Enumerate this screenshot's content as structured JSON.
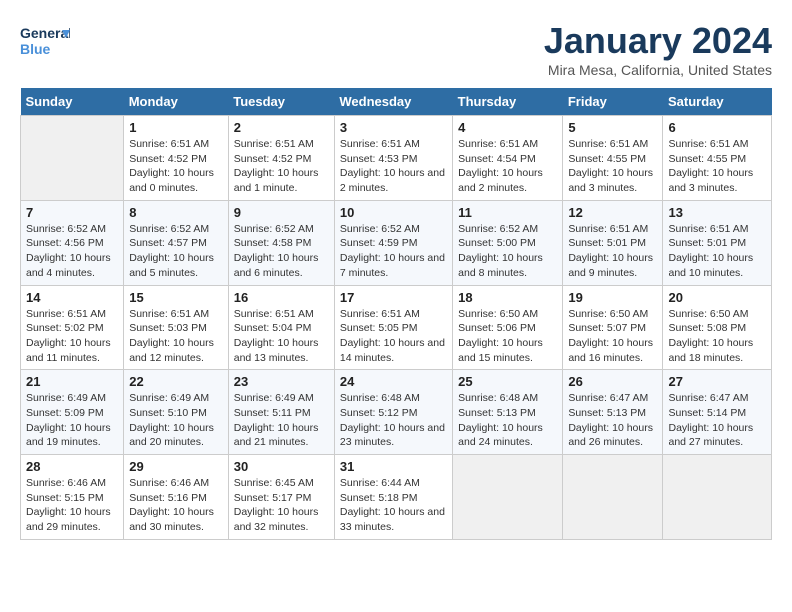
{
  "header": {
    "logo_general": "General",
    "logo_blue": "Blue",
    "title": "January 2024",
    "subtitle": "Mira Mesa, California, United States"
  },
  "days_of_week": [
    "Sunday",
    "Monday",
    "Tuesday",
    "Wednesday",
    "Thursday",
    "Friday",
    "Saturday"
  ],
  "weeks": [
    [
      {
        "day": "",
        "sunrise": "",
        "sunset": "",
        "daylight": ""
      },
      {
        "day": "1",
        "sunrise": "Sunrise: 6:51 AM",
        "sunset": "Sunset: 4:52 PM",
        "daylight": "Daylight: 10 hours and 0 minutes."
      },
      {
        "day": "2",
        "sunrise": "Sunrise: 6:51 AM",
        "sunset": "Sunset: 4:52 PM",
        "daylight": "Daylight: 10 hours and 1 minute."
      },
      {
        "day": "3",
        "sunrise": "Sunrise: 6:51 AM",
        "sunset": "Sunset: 4:53 PM",
        "daylight": "Daylight: 10 hours and 2 minutes."
      },
      {
        "day": "4",
        "sunrise": "Sunrise: 6:51 AM",
        "sunset": "Sunset: 4:54 PM",
        "daylight": "Daylight: 10 hours and 2 minutes."
      },
      {
        "day": "5",
        "sunrise": "Sunrise: 6:51 AM",
        "sunset": "Sunset: 4:55 PM",
        "daylight": "Daylight: 10 hours and 3 minutes."
      },
      {
        "day": "6",
        "sunrise": "Sunrise: 6:51 AM",
        "sunset": "Sunset: 4:55 PM",
        "daylight": "Daylight: 10 hours and 3 minutes."
      }
    ],
    [
      {
        "day": "7",
        "sunrise": "Sunrise: 6:52 AM",
        "sunset": "Sunset: 4:56 PM",
        "daylight": "Daylight: 10 hours and 4 minutes."
      },
      {
        "day": "8",
        "sunrise": "Sunrise: 6:52 AM",
        "sunset": "Sunset: 4:57 PM",
        "daylight": "Daylight: 10 hours and 5 minutes."
      },
      {
        "day": "9",
        "sunrise": "Sunrise: 6:52 AM",
        "sunset": "Sunset: 4:58 PM",
        "daylight": "Daylight: 10 hours and 6 minutes."
      },
      {
        "day": "10",
        "sunrise": "Sunrise: 6:52 AM",
        "sunset": "Sunset: 4:59 PM",
        "daylight": "Daylight: 10 hours and 7 minutes."
      },
      {
        "day": "11",
        "sunrise": "Sunrise: 6:52 AM",
        "sunset": "Sunset: 5:00 PM",
        "daylight": "Daylight: 10 hours and 8 minutes."
      },
      {
        "day": "12",
        "sunrise": "Sunrise: 6:51 AM",
        "sunset": "Sunset: 5:01 PM",
        "daylight": "Daylight: 10 hours and 9 minutes."
      },
      {
        "day": "13",
        "sunrise": "Sunrise: 6:51 AM",
        "sunset": "Sunset: 5:01 PM",
        "daylight": "Daylight: 10 hours and 10 minutes."
      }
    ],
    [
      {
        "day": "14",
        "sunrise": "Sunrise: 6:51 AM",
        "sunset": "Sunset: 5:02 PM",
        "daylight": "Daylight: 10 hours and 11 minutes."
      },
      {
        "day": "15",
        "sunrise": "Sunrise: 6:51 AM",
        "sunset": "Sunset: 5:03 PM",
        "daylight": "Daylight: 10 hours and 12 minutes."
      },
      {
        "day": "16",
        "sunrise": "Sunrise: 6:51 AM",
        "sunset": "Sunset: 5:04 PM",
        "daylight": "Daylight: 10 hours and 13 minutes."
      },
      {
        "day": "17",
        "sunrise": "Sunrise: 6:51 AM",
        "sunset": "Sunset: 5:05 PM",
        "daylight": "Daylight: 10 hours and 14 minutes."
      },
      {
        "day": "18",
        "sunrise": "Sunrise: 6:50 AM",
        "sunset": "Sunset: 5:06 PM",
        "daylight": "Daylight: 10 hours and 15 minutes."
      },
      {
        "day": "19",
        "sunrise": "Sunrise: 6:50 AM",
        "sunset": "Sunset: 5:07 PM",
        "daylight": "Daylight: 10 hours and 16 minutes."
      },
      {
        "day": "20",
        "sunrise": "Sunrise: 6:50 AM",
        "sunset": "Sunset: 5:08 PM",
        "daylight": "Daylight: 10 hours and 18 minutes."
      }
    ],
    [
      {
        "day": "21",
        "sunrise": "Sunrise: 6:49 AM",
        "sunset": "Sunset: 5:09 PM",
        "daylight": "Daylight: 10 hours and 19 minutes."
      },
      {
        "day": "22",
        "sunrise": "Sunrise: 6:49 AM",
        "sunset": "Sunset: 5:10 PM",
        "daylight": "Daylight: 10 hours and 20 minutes."
      },
      {
        "day": "23",
        "sunrise": "Sunrise: 6:49 AM",
        "sunset": "Sunset: 5:11 PM",
        "daylight": "Daylight: 10 hours and 21 minutes."
      },
      {
        "day": "24",
        "sunrise": "Sunrise: 6:48 AM",
        "sunset": "Sunset: 5:12 PM",
        "daylight": "Daylight: 10 hours and 23 minutes."
      },
      {
        "day": "25",
        "sunrise": "Sunrise: 6:48 AM",
        "sunset": "Sunset: 5:13 PM",
        "daylight": "Daylight: 10 hours and 24 minutes."
      },
      {
        "day": "26",
        "sunrise": "Sunrise: 6:47 AM",
        "sunset": "Sunset: 5:13 PM",
        "daylight": "Daylight: 10 hours and 26 minutes."
      },
      {
        "day": "27",
        "sunrise": "Sunrise: 6:47 AM",
        "sunset": "Sunset: 5:14 PM",
        "daylight": "Daylight: 10 hours and 27 minutes."
      }
    ],
    [
      {
        "day": "28",
        "sunrise": "Sunrise: 6:46 AM",
        "sunset": "Sunset: 5:15 PM",
        "daylight": "Daylight: 10 hours and 29 minutes."
      },
      {
        "day": "29",
        "sunrise": "Sunrise: 6:46 AM",
        "sunset": "Sunset: 5:16 PM",
        "daylight": "Daylight: 10 hours and 30 minutes."
      },
      {
        "day": "30",
        "sunrise": "Sunrise: 6:45 AM",
        "sunset": "Sunset: 5:17 PM",
        "daylight": "Daylight: 10 hours and 32 minutes."
      },
      {
        "day": "31",
        "sunrise": "Sunrise: 6:44 AM",
        "sunset": "Sunset: 5:18 PM",
        "daylight": "Daylight: 10 hours and 33 minutes."
      },
      {
        "day": "",
        "sunrise": "",
        "sunset": "",
        "daylight": ""
      },
      {
        "day": "",
        "sunrise": "",
        "sunset": "",
        "daylight": ""
      },
      {
        "day": "",
        "sunrise": "",
        "sunset": "",
        "daylight": ""
      }
    ]
  ]
}
